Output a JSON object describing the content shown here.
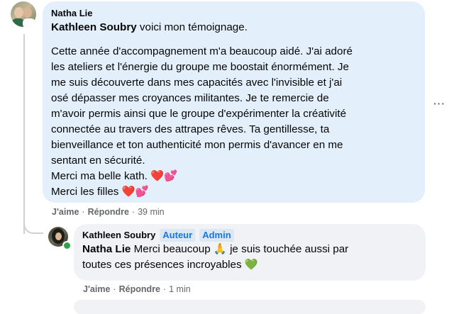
{
  "comment": {
    "author": "Natha Lie",
    "mention": "Kathleen Soubry",
    "first_line": "voici mon témoignage.",
    "lines": [
      "Cette année d'accompagnement m'a beaucoup aidé. J'ai adoré",
      "les ateliers et l'énergie du groupe me boostait énormément. Je",
      "me suis découverte dans mes capacités avec l'invisible et j'ai",
      "osé dépasser mes croyances militantes. Je te remercie de",
      "m'avoir permis ainsi que le groupe d'expérimenter la créativité",
      "connectée au travers des attrapes rêves. Ta gentillesse, ta",
      "bienveillance et ton authenticité mon permis d'avancer en me",
      "sentant en sécurité."
    ],
    "closing_1": "Merci ma belle kath.",
    "closing_2": "Merci les filles",
    "emoji_hearts": "❤️💕",
    "like_label": "J'aime",
    "reply_label": "Répondre",
    "time": "39 min",
    "more_icon": "···"
  },
  "reply": {
    "author": "Kathleen Soubry",
    "badges": [
      "Auteur",
      "Admin"
    ],
    "mention": "Natha Lie",
    "line_1": "Merci beaucoup",
    "emoji_pray": "🙏",
    "line_1_rest": "je suis touchée aussi par",
    "line_2": "toutes ces présences incroyables",
    "emoji_green_heart": "💚",
    "like_label": "J'aime",
    "reply_label": "Répondre",
    "time": "1 min"
  },
  "separator": "·"
}
